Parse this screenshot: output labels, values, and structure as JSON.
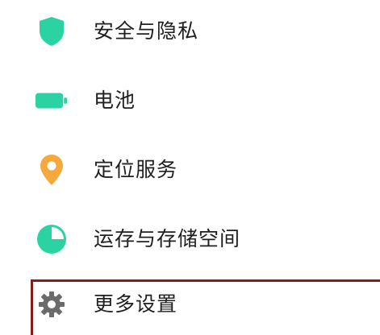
{
  "settings": {
    "items": [
      {
        "id": "security",
        "label": "安全与隐私",
        "icon": "shield-icon",
        "icon_color": "#2bd3a3"
      },
      {
        "id": "battery",
        "label": "电池",
        "icon": "battery-icon",
        "icon_color": "#2bd3a3"
      },
      {
        "id": "location",
        "label": "定位服务",
        "icon": "location-pin-icon",
        "icon_color": "#f5a83c"
      },
      {
        "id": "storage",
        "label": "运存与存储空间",
        "icon": "pie-chart-icon",
        "icon_color": "#2bd3a3"
      },
      {
        "id": "more",
        "label": "更多设置",
        "icon": "gear-icon",
        "icon_color": "#6b6b6b"
      }
    ]
  },
  "highlight_color": "#8b1c1c"
}
